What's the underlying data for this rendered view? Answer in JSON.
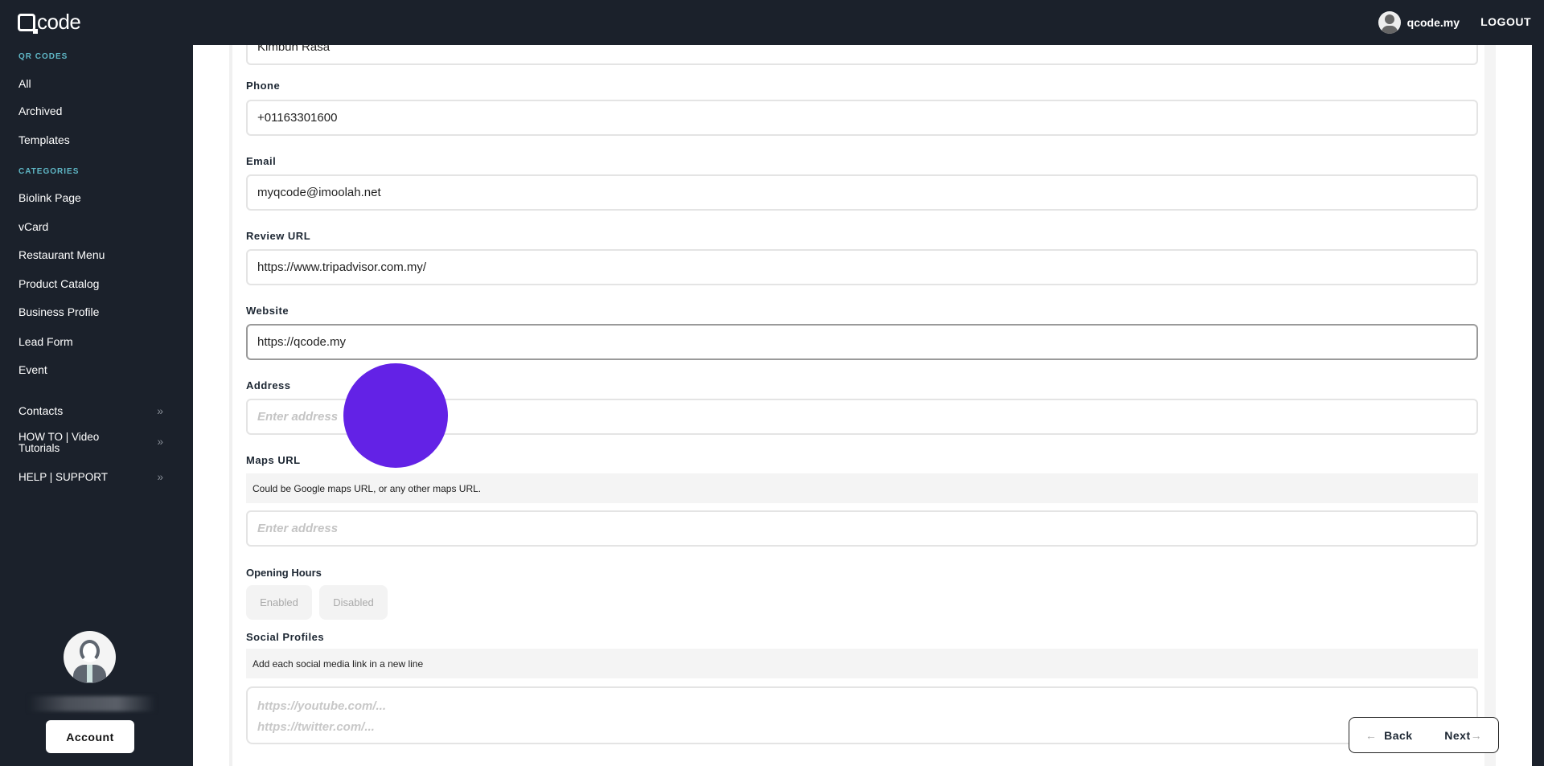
{
  "header": {
    "brand": "code",
    "username": "qcode.my",
    "logout": "LOGOUT"
  },
  "sidebar": {
    "qr_section": "QR CODES",
    "qr_items": [
      "All",
      "Archived",
      "Templates"
    ],
    "cat_section": "CATEGORIES",
    "cat_items": [
      "Biolink Page",
      "vCard",
      "Restaurant Menu",
      "Product Catalog",
      "Business Profile",
      "Lead Form",
      "Event"
    ],
    "extra_items": [
      "Contacts",
      "HOW TO | Video Tutorials",
      "HELP | SUPPORT"
    ],
    "account_button": "Account"
  },
  "form": {
    "top_value": "Kimbun Rasa",
    "phone": {
      "label": "Phone",
      "value": "+01163301600"
    },
    "email": {
      "label": "Email",
      "value": "myqcode@imoolah.net"
    },
    "review": {
      "label": "Review URL",
      "value": "https://www.tripadvisor.com.my/"
    },
    "website": {
      "label": "Website",
      "value": "https://qcode.my"
    },
    "address": {
      "label": "Address",
      "placeholder": "Enter address"
    },
    "maps": {
      "label": "Maps URL",
      "help": "Could be Google maps URL, or any other maps URL.",
      "placeholder": "Enter address"
    },
    "hours": {
      "label": "Opening Hours",
      "enabled": "Enabled",
      "disabled": "Disabled"
    },
    "social": {
      "label": "Social Profiles",
      "help": "Add each social media link in a new line",
      "placeholder_lines": [
        "https://youtube.com/...",
        "https://twitter.com/..."
      ]
    }
  },
  "nav": {
    "back": "Back",
    "next": "Next"
  },
  "colors": {
    "cursor": "#6322e6",
    "accent": "#5fb7c6"
  }
}
